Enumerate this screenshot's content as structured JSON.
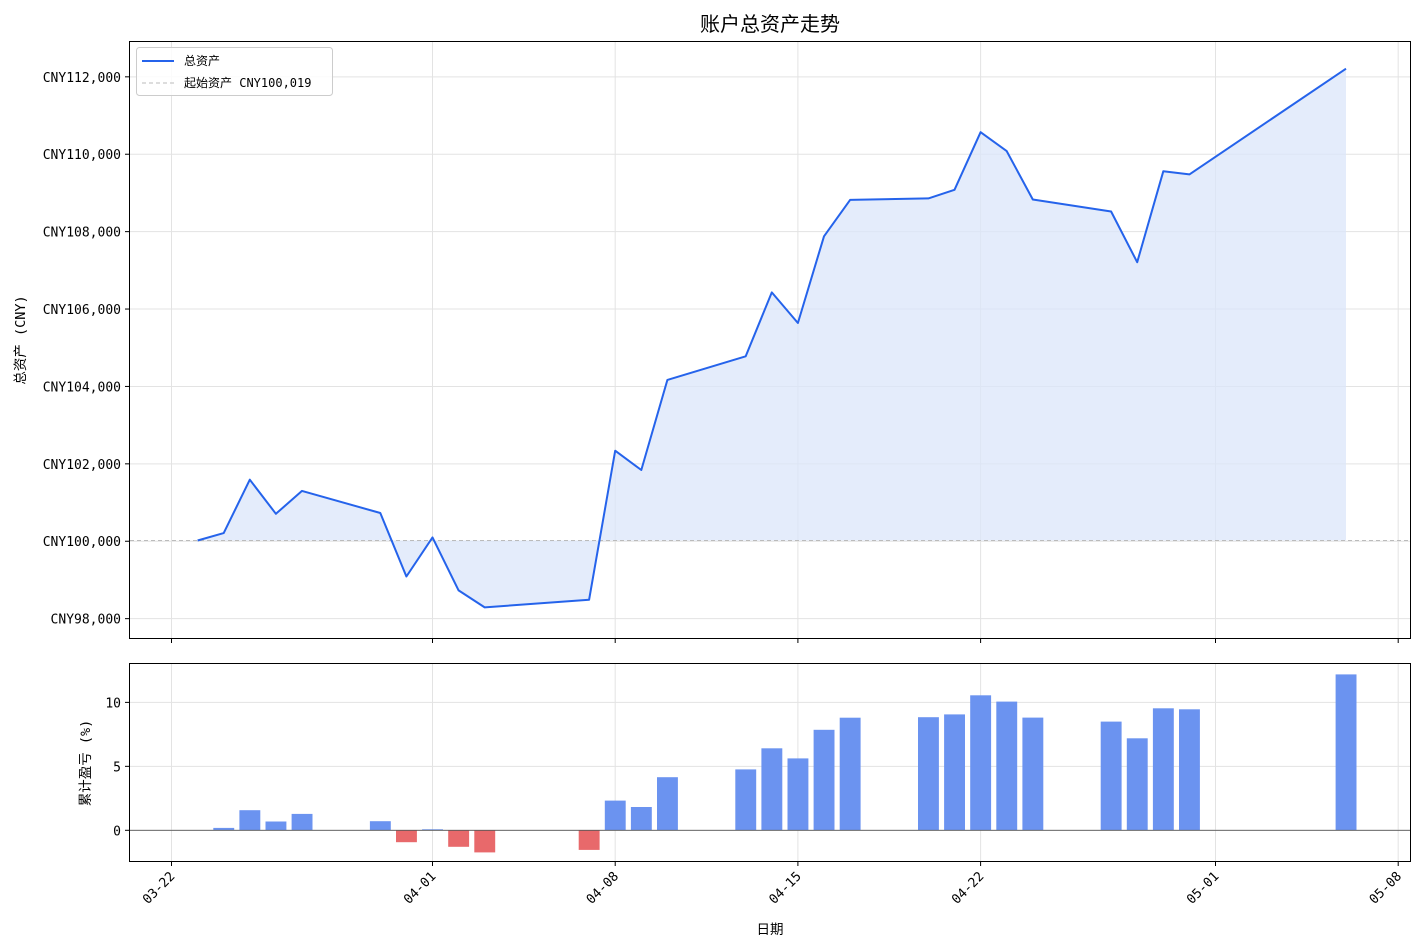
{
  "chart_data": [
    {
      "type": "line",
      "title": "账户总资产走势",
      "xlabel": "",
      "ylabel": "总资产 (CNY)",
      "ylim": [
        97500,
        112900
      ],
      "yticks": [
        "CNY98,000",
        "CNY100,000",
        "CNY102,000",
        "CNY104,000",
        "CNY106,000",
        "CNY108,000",
        "CNY110,000",
        "CNY112,000"
      ],
      "ytick_values": [
        98000,
        100000,
        102000,
        104000,
        106000,
        108000,
        110000,
        112000
      ],
      "grid": true,
      "legend_position": "top-left",
      "baseline": {
        "value": 100019,
        "label": "起始资产 CNY100,019",
        "color": "#bbbbbb"
      },
      "series": [
        {
          "name": "总资产",
          "color": "#2563eb",
          "fill_color": "#dbe6f9",
          "points": [
            [
              "2024-03-23",
              100019
            ],
            [
              "2024-03-24",
              100210
            ],
            [
              "2024-03-25",
              101590
            ],
            [
              "2024-03-26",
              100710
            ],
            [
              "2024-03-27",
              101300
            ],
            [
              "2024-03-30",
              100730
            ],
            [
              "2024-03-31",
              99090
            ],
            [
              "2024-04-01",
              100100
            ],
            [
              "2024-04-02",
              98730
            ],
            [
              "2024-04-03",
              98290
            ],
            [
              "2024-04-07",
              98490
            ],
            [
              "2024-04-08",
              102340
            ],
            [
              "2024-04-09",
              101840
            ],
            [
              "2024-04-10",
              104170
            ],
            [
              "2024-04-13",
              104780
            ],
            [
              "2024-04-14",
              106430
            ],
            [
              "2024-04-15",
              105640
            ],
            [
              "2024-04-16",
              107880
            ],
            [
              "2024-04-17",
              108820
            ],
            [
              "2024-04-20",
              108860
            ],
            [
              "2024-04-21",
              109080
            ],
            [
              "2024-04-22",
              110570
            ],
            [
              "2024-04-23",
              110080
            ],
            [
              "2024-04-24",
              108830
            ],
            [
              "2024-04-27",
              108520
            ],
            [
              "2024-04-28",
              107210
            ],
            [
              "2024-04-29",
              109560
            ],
            [
              "2024-04-30",
              109480
            ],
            [
              "2024-05-06",
              112210
            ]
          ]
        }
      ]
    },
    {
      "type": "bar",
      "xlabel": "日期",
      "ylabel": "累计盈亏 (%)",
      "ylim": [
        -2.4,
        13.0
      ],
      "yticks": [
        "0",
        "5",
        "10"
      ],
      "ytick_values": [
        0,
        5,
        10
      ],
      "xticks": [
        "03-22",
        "04-01",
        "04-08",
        "04-15",
        "04-22",
        "05-01",
        "05-08"
      ],
      "xtick_dates": [
        "2024-03-22",
        "2024-04-01",
        "2024-04-08",
        "2024-04-15",
        "2024-04-22",
        "2024-05-01",
        "2024-05-08"
      ],
      "grid": true,
      "positive_color": "#6b93f0",
      "negative_color": "#e8696b",
      "bars": [
        [
          "2024-03-24",
          0.19
        ],
        [
          "2024-03-25",
          1.57
        ],
        [
          "2024-03-26",
          0.69
        ],
        [
          "2024-03-27",
          1.28
        ],
        [
          "2024-03-30",
          0.71
        ],
        [
          "2024-03-31",
          -0.93
        ],
        [
          "2024-04-01",
          0.08
        ],
        [
          "2024-04-02",
          -1.29
        ],
        [
          "2024-04-03",
          -1.73
        ],
        [
          "2024-04-07",
          -1.53
        ],
        [
          "2024-04-08",
          2.32
        ],
        [
          "2024-04-09",
          1.82
        ],
        [
          "2024-04-10",
          4.15
        ],
        [
          "2024-04-13",
          4.76
        ],
        [
          "2024-04-14",
          6.41
        ],
        [
          "2024-04-15",
          5.62
        ],
        [
          "2024-04-16",
          7.86
        ],
        [
          "2024-04-17",
          8.8
        ],
        [
          "2024-04-20",
          8.84
        ],
        [
          "2024-04-21",
          9.06
        ],
        [
          "2024-04-22",
          10.55
        ],
        [
          "2024-04-23",
          10.06
        ],
        [
          "2024-04-24",
          8.81
        ],
        [
          "2024-04-27",
          8.5
        ],
        [
          "2024-04-28",
          7.19
        ],
        [
          "2024-04-29",
          9.54
        ],
        [
          "2024-04-30",
          9.46
        ],
        [
          "2024-05-06",
          12.19
        ]
      ]
    }
  ]
}
